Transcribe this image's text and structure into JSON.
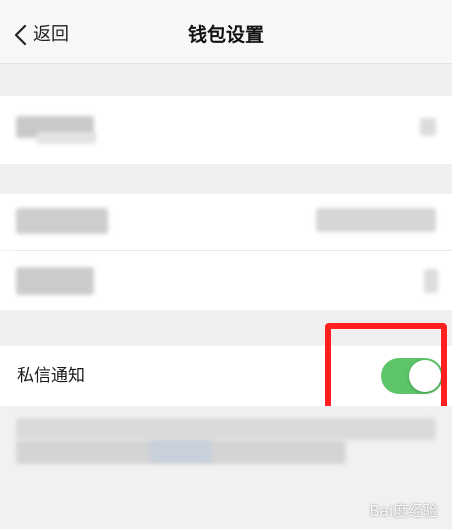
{
  "nav": {
    "back_label": "返回",
    "title": "钱包设置"
  },
  "settings": {
    "private_message_notify_label": "私信通知",
    "private_message_notify_enabled": true
  },
  "colors": {
    "toggle_on": "#5cc56a",
    "highlight_box": "#ff1f1f"
  },
  "watermark": "Bai度经验"
}
